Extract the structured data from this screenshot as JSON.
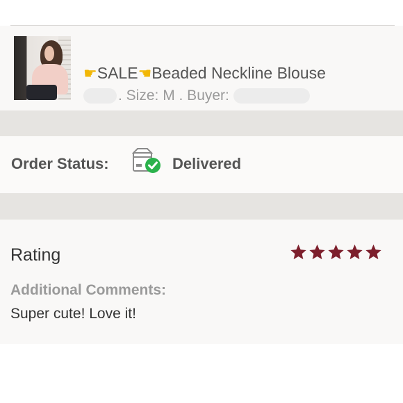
{
  "item": {
    "title_prefix_icon": "pointing-right-hand-icon",
    "sale_label": "SALE",
    "title_suffix_icon": "pointing-left-hand-icon",
    "title": "Beaded Neckline Blouse",
    "size_text": ". Size: M . Buyer:"
  },
  "order": {
    "status_label": "Order Status:",
    "status_icon": "delivered-box-check-icon",
    "status_value": "Delivered"
  },
  "rating": {
    "label": "Rating",
    "stars": 5,
    "max_stars": 5,
    "star_color": "#7d1f2c",
    "comments_label": "Additional Comments:",
    "comments": "Super cute! Love it!"
  },
  "colors": {
    "check_green": "#2bb24c",
    "divider_band": "#e6e4e1"
  }
}
